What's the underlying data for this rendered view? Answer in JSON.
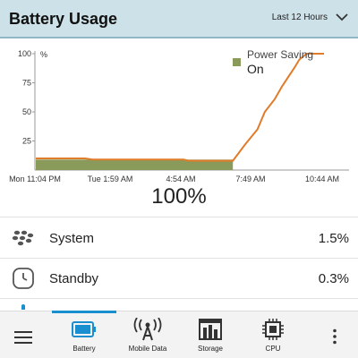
{
  "header": {
    "title": "Battery Usage",
    "range_label": "Last 12 Hours"
  },
  "chart_data": {
    "type": "line",
    "y_unit_label": "%",
    "yticks": [
      "100",
      "75",
      "50",
      "25"
    ],
    "ylim": [
      0,
      100
    ],
    "xticks": [
      "Mon 11:04 PM",
      "Tue 1:59 AM",
      "4:54 AM",
      "7:49 AM",
      "10:44 AM"
    ],
    "legend": {
      "label_line1": "Power Saving",
      "label_line2": "On",
      "color": "#8a9a5b",
      "placement": "top-right"
    },
    "series": [
      {
        "values_hours_since_start": [
          0,
          2.0,
          2.3,
          4.9,
          6.0,
          6.2,
          8.0,
          8.5,
          9.0,
          9.3,
          9.7,
          10.0,
          10.5,
          10.7,
          11.0,
          11.7
        ],
        "values_percent": [
          10,
          10,
          9,
          9,
          9,
          8,
          8,
          22,
          35,
          50,
          61,
          72,
          88,
          95,
          100,
          100
        ],
        "color": "#e07b2a"
      }
    ],
    "power_saving_band": {
      "from_hours": 0,
      "to_hours": 8.0,
      "level_percent": 9,
      "color": "#8a9a5b"
    },
    "grid": false
  },
  "battery_level": "100%",
  "usage_rows": [
    {
      "label": "System",
      "value": "1.5%"
    },
    {
      "label": "Standby",
      "value": "0.3%"
    }
  ],
  "bottom_nav": {
    "items": [
      {
        "label": "Battery",
        "active": true
      },
      {
        "label": "Mobile Data"
      },
      {
        "label": "Storage"
      },
      {
        "label": "CPU"
      }
    ]
  },
  "colors": {
    "header_bg": "#cde1e8",
    "accent": "#1a8fd0",
    "line": "#e07b2a",
    "power_saving": "#8a9a5b"
  }
}
